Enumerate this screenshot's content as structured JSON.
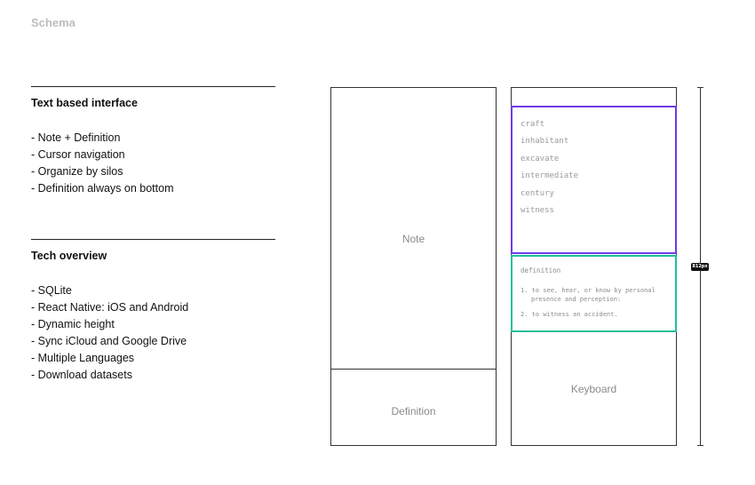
{
  "page": {
    "title": "Schema"
  },
  "sections": [
    {
      "heading": "Text based interface",
      "items": [
        "- Note + Definition",
        "- Cursor navigation",
        "- Organize by silos",
        "- Definition always on bottom"
      ]
    },
    {
      "heading": "Tech overview",
      "items": [
        "- SQLite",
        "- React Native: iOS and Android",
        "- Dynamic height",
        "- Sync iCloud and Google Drive",
        "- Multiple Languages",
        "- Download datasets"
      ]
    }
  ],
  "wireframe_a": {
    "note_label": "Note",
    "definition_label": "Definition"
  },
  "wireframe_b": {
    "word_list": [
      "craft",
      "inhabitant",
      "excavate",
      "intermediate",
      "century",
      "witness"
    ],
    "definition": {
      "heading": "definition",
      "entries": [
        "1. to see, hear, or know by personal presence and perception:",
        "2. to witness an accident."
      ]
    },
    "keyboard_label": "Keyboard"
  },
  "ruler": {
    "label": "812px"
  },
  "colors": {
    "list_border": "#6b3de6",
    "definition_border": "#1fbf9b",
    "muted_title": "#bdbdbd"
  }
}
